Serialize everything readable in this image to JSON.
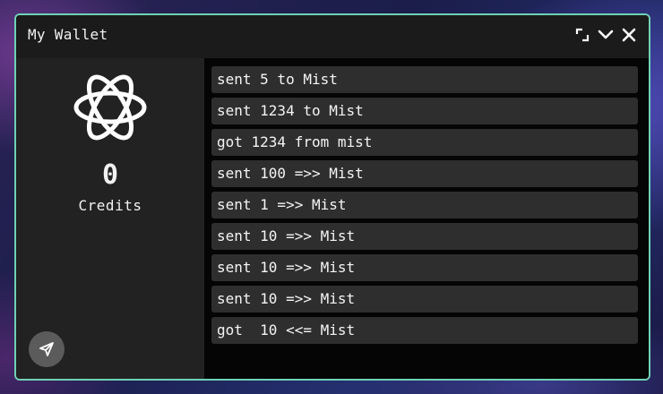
{
  "window": {
    "title": "My Wallet",
    "controls": [
      {
        "name": "restore-icon"
      },
      {
        "name": "chevron-down-icon"
      },
      {
        "name": "close-icon"
      }
    ],
    "border_color": "#6fd1b5"
  },
  "sidebar": {
    "logo_icon": "atom-icon",
    "credits_value": "0",
    "credits_label": "Credits",
    "send_icon": "send-icon"
  },
  "transactions": [
    {
      "text": "sent 5 to Mist"
    },
    {
      "text": "sent 1234 to Mist"
    },
    {
      "text": "got 1234 from mist"
    },
    {
      "text": "sent 100 =>> Mist"
    },
    {
      "text": "sent 1 =>> Mist"
    },
    {
      "text": "sent 10 =>> Mist"
    },
    {
      "text": "sent 10 =>> Mist"
    },
    {
      "text": "sent 10 =>> Mist"
    },
    {
      "text": "got  10 <<= Mist"
    }
  ]
}
